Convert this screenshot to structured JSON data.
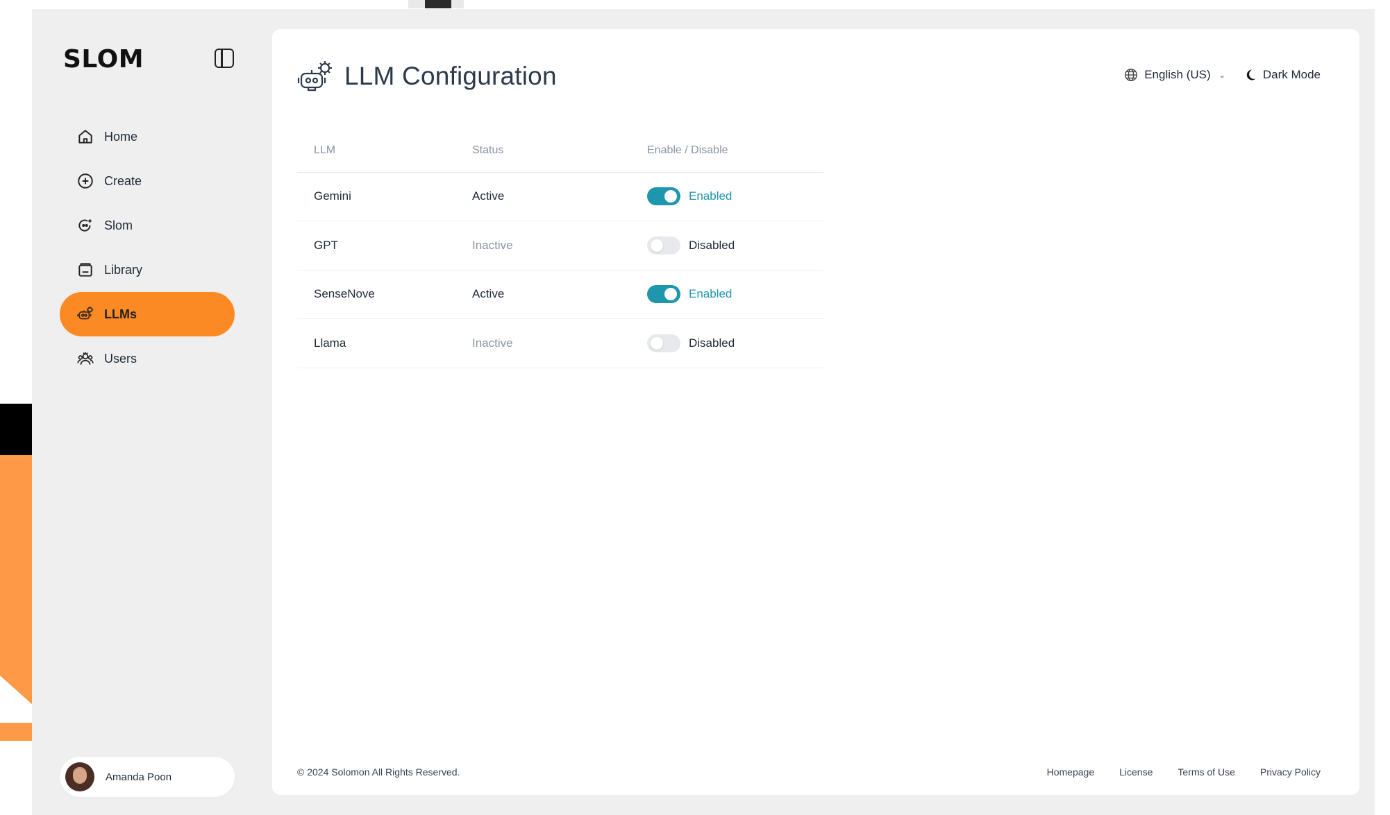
{
  "sidebar": {
    "logo": "SLOM",
    "items": [
      {
        "label": "Home",
        "icon": "home-icon"
      },
      {
        "label": "Create",
        "icon": "plus-circle-icon"
      },
      {
        "label": "Slom",
        "icon": "chat-bot-icon"
      },
      {
        "label": "Library",
        "icon": "library-icon"
      },
      {
        "label": "LLMs",
        "icon": "robot-icon",
        "active": true
      },
      {
        "label": "Users",
        "icon": "users-icon"
      }
    ],
    "user": {
      "name": "Amanda Poon"
    }
  },
  "header": {
    "title": "LLM Configuration",
    "language": "English (US)",
    "dark_mode_label": "Dark Mode"
  },
  "table": {
    "columns": [
      "LLM",
      "Status",
      "Enable / Disable"
    ],
    "rows": [
      {
        "name": "Gemini",
        "status": "Active",
        "toggle": "Enabled",
        "on": true
      },
      {
        "name": "GPT",
        "status": "Inactive",
        "toggle": "Disabled",
        "on": false
      },
      {
        "name": "SenseNove",
        "status": "Active",
        "toggle": "Enabled",
        "on": true
      },
      {
        "name": "Llama",
        "status": "Inactive",
        "toggle": "Disabled",
        "on": false
      }
    ]
  },
  "footer": {
    "copyright": "© 2024 Solomon All Rights Reserved.",
    "links": [
      "Homepage",
      "License",
      "Terms of Use",
      "Privacy Policy"
    ]
  },
  "colors": {
    "accent": "#fb8a24",
    "toggle_on": "#1e96ad",
    "toggle_off": "#e7e9ec"
  }
}
